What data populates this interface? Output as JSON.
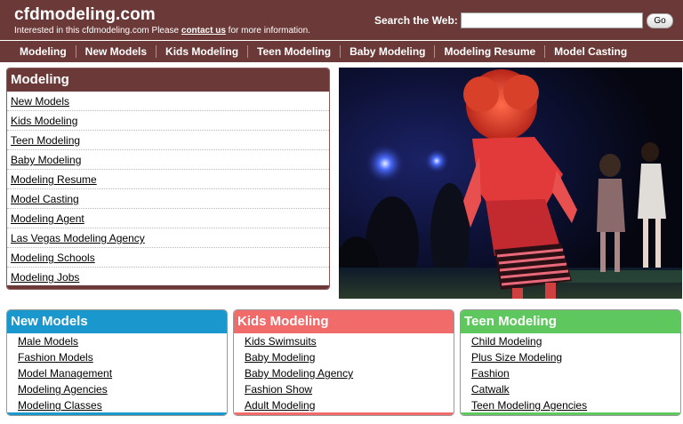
{
  "header": {
    "site_title": "cfdmodeling.com",
    "tagline_pre": "Interested in this cfdmodeling.com Please ",
    "tagline_link": "contact us",
    "tagline_post": " for more information.",
    "search_label": "Search the Web:",
    "search_value": "",
    "go_label": "Go",
    "bg_color": "#6b3a38"
  },
  "nav": {
    "items": [
      "Modeling",
      "New Models",
      "Kids Modeling",
      "Teen Modeling",
      "Baby Modeling",
      "Modeling Resume",
      "Model Casting"
    ]
  },
  "modeling_box": {
    "title": "Modeling",
    "color": "#6b3a38",
    "links": [
      "New Models",
      "Kids Modeling",
      "Teen Modeling",
      "Baby Modeling",
      "Modeling Resume",
      "Model Casting",
      "Modeling Agent",
      "Las Vegas Modeling Agency",
      "Modeling Schools",
      "Modeling Jobs"
    ]
  },
  "category_boxes": [
    {
      "title": "New Models",
      "color": "#1a97cc",
      "links": [
        "Male Models",
        "Fashion Models",
        "Model Management",
        "Modeling Agencies",
        "Modeling Classes"
      ]
    },
    {
      "title": "Kids Modeling",
      "color": "#f26b6b",
      "links": [
        "Kids Swimsuits",
        "Baby Modeling",
        "Baby Modeling Agency",
        "Fashion Show",
        "Adult Modeling"
      ]
    },
    {
      "title": "Teen Modeling",
      "color": "#5ec75e",
      "links": [
        "Child Modeling",
        "Plus Size Modeling",
        "Fashion",
        "Catwalk",
        "Teen Modeling Agencies"
      ]
    }
  ]
}
